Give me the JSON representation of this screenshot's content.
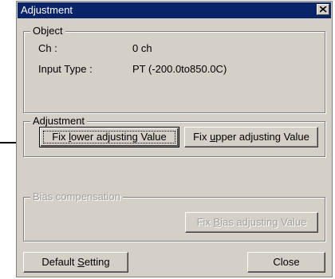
{
  "window": {
    "title": "Adjustment",
    "close_icon": "close-icon"
  },
  "object_group": {
    "legend": "Object",
    "ch_label": "Ch :",
    "ch_value": "0 ch",
    "input_type_label": "Input Type :",
    "input_type_value": "PT (-200.0to850.0C)"
  },
  "adjustment_group": {
    "legend": "Adjustment",
    "fix_lower_label_pre": "Fix ",
    "fix_lower_label_mnemonic": "l",
    "fix_lower_label_post": "ower adjusting Value",
    "fix_upper_label_pre": "Fix ",
    "fix_upper_label_mnemonic": "u",
    "fix_upper_label_post": "pper adjusting Value"
  },
  "bias_group": {
    "legend": "Bias compensation",
    "fix_bias_label_pre": "Fix ",
    "fix_bias_label_mnemonic": "B",
    "fix_bias_label_post": "ias adjusting Value",
    "enabled": false
  },
  "footer": {
    "default_label_pre": "Default ",
    "default_label_mnemonic": "S",
    "default_label_post": "etting",
    "close_label": "Close"
  },
  "colors": {
    "titlebar": "#0a246a",
    "dialog_face": "#d4d0c8",
    "disabled_text": "#a0a0a0"
  }
}
